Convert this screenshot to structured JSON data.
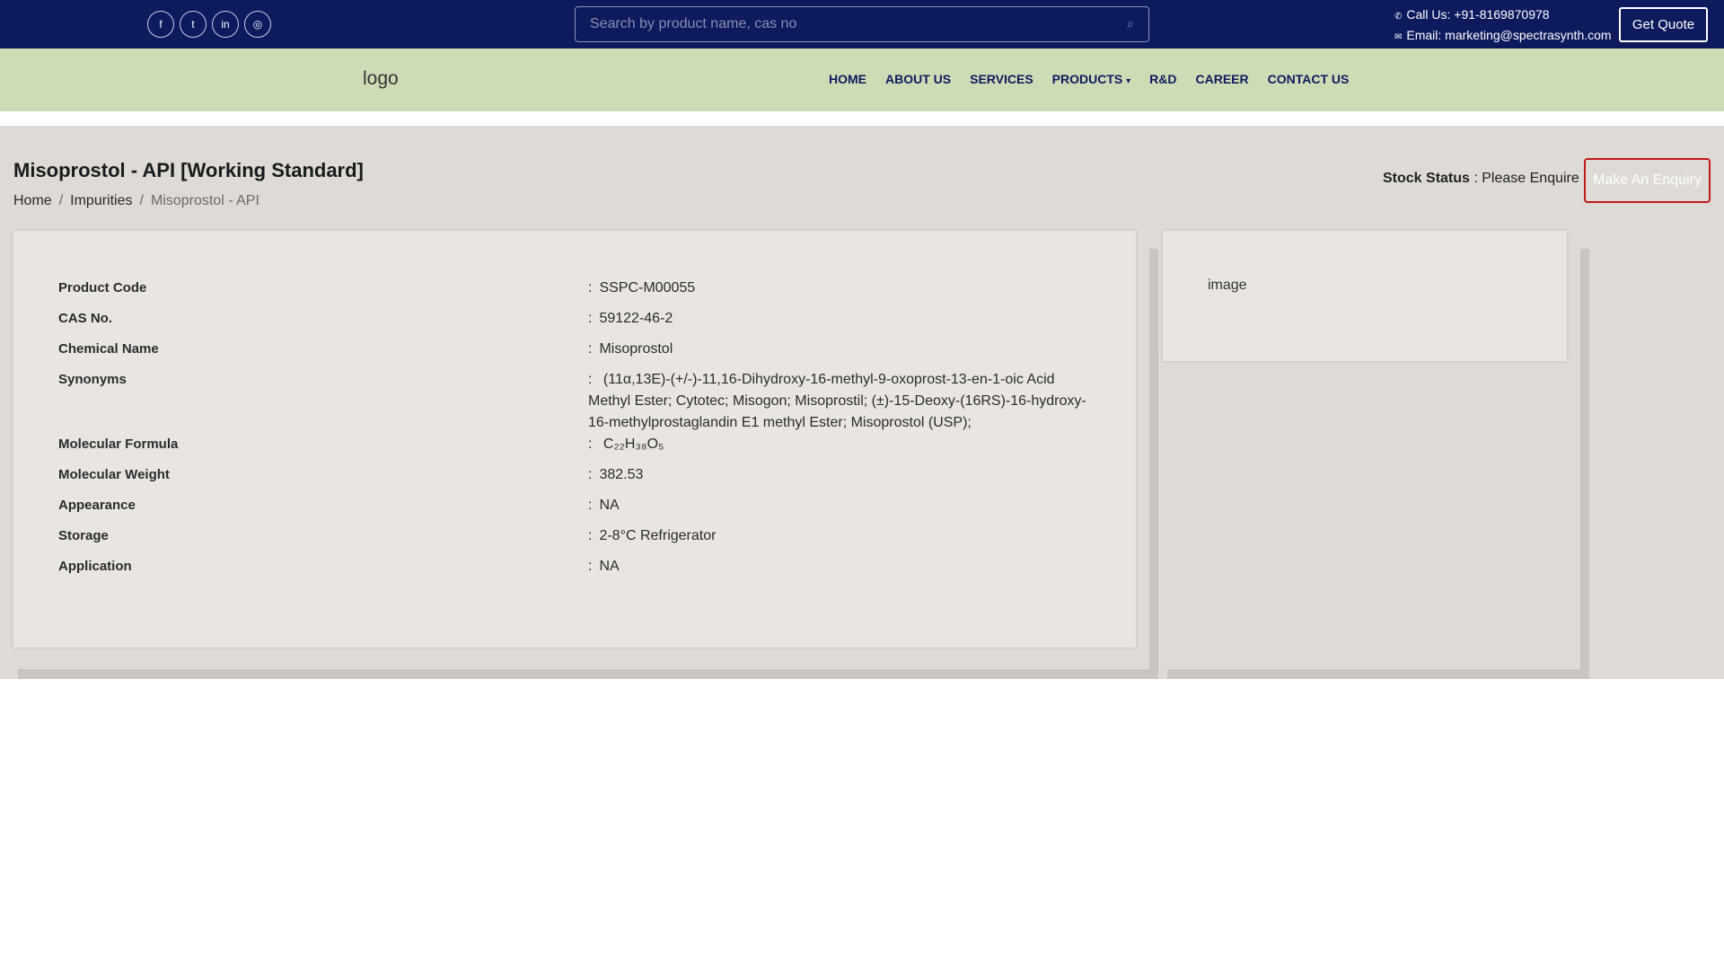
{
  "topbar": {
    "socials": [
      {
        "icon": "facebook-icon",
        "glyph": "f"
      },
      {
        "icon": "twitter-icon",
        "glyph": "t"
      },
      {
        "icon": "linkedin-icon",
        "glyph": "in"
      },
      {
        "icon": "instagram-icon",
        "glyph": "◎"
      }
    ],
    "search_placeholder": "Search by product name, cas no",
    "phone": "Call Us: +91-8169870978",
    "email": "Email: marketing@spectrasynth.com",
    "get_quote_label": "Get Quote"
  },
  "nav": {
    "logo_alt": "logo",
    "items": [
      "HOME",
      "ABOUT US",
      "SERVICES",
      "PRODUCTS",
      "R&D",
      "CAREER",
      "CONTACT US"
    ]
  },
  "product": {
    "title": "Misoprostol - API [Working Standard]",
    "breadcrumb": [
      "Home",
      "Impurities",
      "Misoprostol - API"
    ],
    "stock_label": "Stock Status",
    "stock_value": " : Please Enquire",
    "enquiry_label": "Make An Enquiry",
    "image_alt": "image",
    "details": [
      {
        "label": "Product Code",
        "value": "SSPC-M00055"
      },
      {
        "label": "CAS No.",
        "value": "59122-46-2"
      },
      {
        "label": "Chemical Name",
        "value": "Misoprostol"
      },
      {
        "label": "Synonyms",
        "value": "(11α,13E)-(+/-)-11,16-Dihydroxy-16-methyl-9-oxoprost-13-en-1-oic Acid Methyl Ester; Cytotec; Misogon; Misoprostil; (±)-15-Deoxy-(16RS)-16-hydroxy-16-methylprostaglandin E1 methyl Ester; Misoprostol (USP);"
      },
      {
        "label": "Molecular Formula",
        "value": "C₂₂H₃₈O₅"
      },
      {
        "label": "Molecular Weight",
        "value": "382.53"
      },
      {
        "label": "Appearance",
        "value": "NA"
      },
      {
        "label": "Storage",
        "value": "2-8°C Refrigerator"
      },
      {
        "label": "Application",
        "value": "NA"
      }
    ]
  },
  "colors": {
    "topbar_bg": "#0d1a5e",
    "navbar_bg": "#cedcb6",
    "main_bg": "#dedad5",
    "card_bg": "#e9e6e2",
    "enquiry_border": "#c01a1a"
  }
}
